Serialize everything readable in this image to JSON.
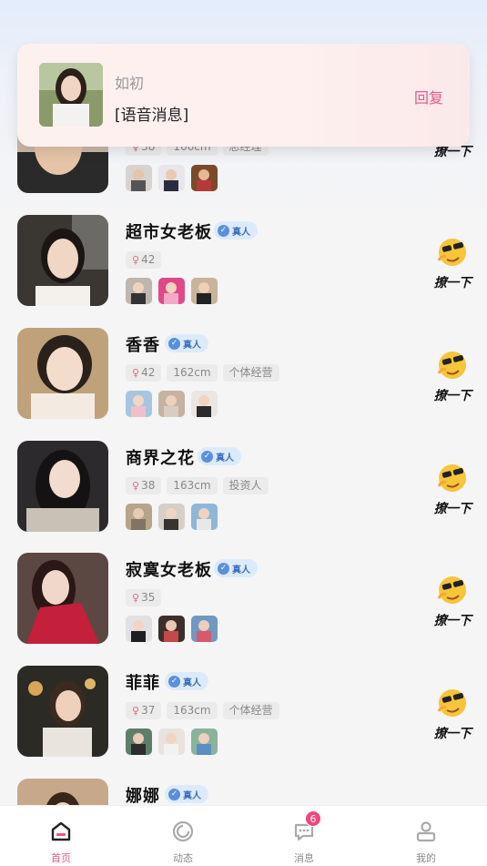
{
  "notification": {
    "sender": "如初",
    "message": "[语音消息]",
    "reply_label": "回复"
  },
  "flirt_label": "撩一下",
  "users": [
    {
      "name": "",
      "verified": false,
      "tags": [
        "38",
        "166cm",
        "总经理"
      ]
    },
    {
      "name": "超市女老板",
      "verified": true,
      "verify_label": "真人",
      "tags": [
        "42"
      ]
    },
    {
      "name": "香香",
      "verified": true,
      "verify_label": "真人",
      "tags": [
        "42",
        "162cm",
        "个体经营"
      ]
    },
    {
      "name": "商界之花",
      "verified": true,
      "verify_label": "真人",
      "tags": [
        "38",
        "163cm",
        "投资人"
      ]
    },
    {
      "name": "寂寞女老板",
      "verified": true,
      "verify_label": "真人",
      "tags": [
        "35"
      ]
    },
    {
      "name": "菲菲",
      "verified": true,
      "verify_label": "真人",
      "tags": [
        "37",
        "163cm",
        "个体经营"
      ]
    },
    {
      "name": "娜娜",
      "verified": true,
      "verify_label": "真人",
      "tags": []
    }
  ],
  "tabbar": {
    "items": [
      {
        "label": "首页",
        "icon": "home-icon",
        "active": true
      },
      {
        "label": "动态",
        "icon": "moments-icon",
        "active": false
      },
      {
        "label": "消息",
        "icon": "message-icon",
        "active": false,
        "badge": "6"
      },
      {
        "label": "我的",
        "icon": "profile-icon",
        "active": false
      }
    ]
  },
  "colors": {
    "accent": "#e7568c",
    "badge": "#f0467e",
    "verify_bg": "#dcebfb",
    "verify_text": "#3b6fbf"
  }
}
